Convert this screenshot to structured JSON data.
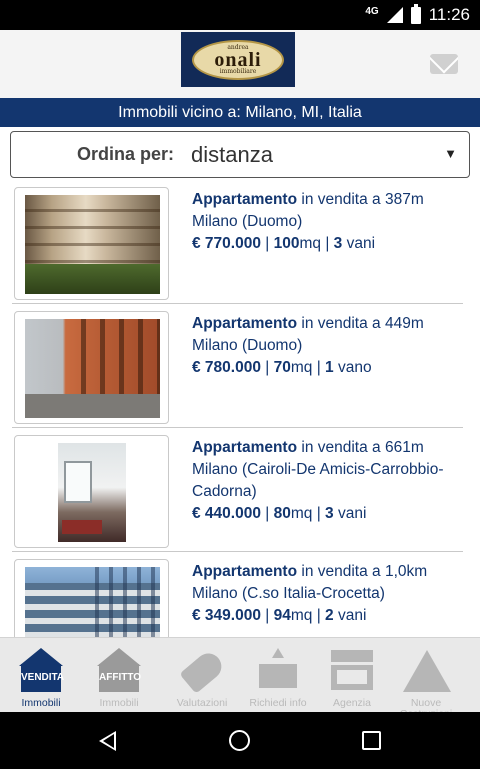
{
  "status_bar": {
    "network": "4G",
    "time": "11:26"
  },
  "header": {
    "logo": {
      "line1": "andrea",
      "name": "onali",
      "line2": "immobiliare"
    }
  },
  "location_bar": {
    "text": "Immobili vicino a: Milano, MI, Italia"
  },
  "sort": {
    "label": "Ordina per:",
    "value": "distanza"
  },
  "listings": [
    {
      "type": "Appartamento",
      "status": " in vendita a 387m",
      "location": "Milano (Duomo)",
      "price": "€ 770.000",
      "sep1": " | ",
      "size": "100",
      "size_unit": "mq",
      "sep2": " | ",
      "rooms": "3",
      "rooms_label": " vani"
    },
    {
      "type": "Appartamento",
      "status": " in vendita a 449m",
      "location": "Milano (Duomo)",
      "price": "€ 780.000",
      "sep1": " | ",
      "size": "70",
      "size_unit": "mq",
      "sep2": " | ",
      "rooms": "1",
      "rooms_label": " vano"
    },
    {
      "type": "Appartamento",
      "status": " in vendita a 661m",
      "location": "Milano (Cairoli-De Amicis-Carrobbio-Cadorna)",
      "price": "€ 440.000",
      "sep1": " | ",
      "size": "80",
      "size_unit": "mq",
      "sep2": " | ",
      "rooms": "3",
      "rooms_label": " vani"
    },
    {
      "type": "Appartamento",
      "status": " in vendita a 1,0km",
      "location": "Milano (C.so Italia-Crocetta)",
      "price": "€ 349.000",
      "sep1": " | ",
      "size": "94",
      "size_unit": "mq",
      "sep2": " | ",
      "rooms": "2",
      "rooms_label": " vani"
    }
  ],
  "bottom_nav": [
    {
      "icon": "house-sale-icon",
      "icon_text": "VENDITA",
      "label": "Immobili",
      "active": true
    },
    {
      "icon": "house-rent-icon",
      "icon_text": "AFFITTO",
      "label": "Immobili",
      "active": false
    },
    {
      "icon": "price-tag-icon",
      "label": "Valutazioni",
      "active": false
    },
    {
      "icon": "upload-envelope-icon",
      "label": "Richiedi info",
      "active": false
    },
    {
      "icon": "storefront-icon",
      "label": "Agenzia",
      "active": false
    },
    {
      "icon": "construction-sign-icon",
      "label": "Nuove Costruzioni",
      "active": false
    }
  ],
  "colors": {
    "brand_navy": "#13366f",
    "inactive_gray": "#b6b6b6"
  }
}
